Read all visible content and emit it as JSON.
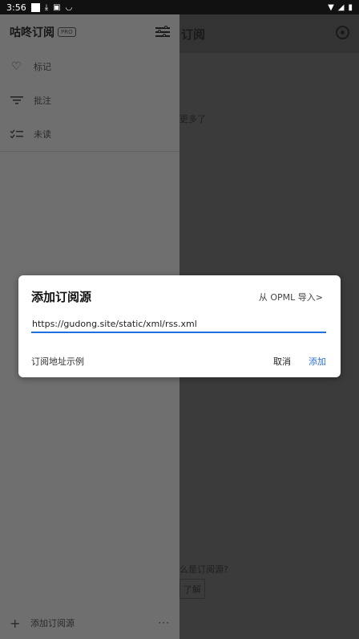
{
  "status_bar": {
    "time": "3:56",
    "icons": [
      "square-icon",
      "download-icon",
      "image-icon",
      "signal-icon",
      "wifi-icon",
      "cell-icon",
      "battery-icon"
    ]
  },
  "main": {
    "title": "订阅",
    "hint": "更多了",
    "question": "么是订阅源?",
    "learn_button": "了解"
  },
  "drawer": {
    "title": "咕咚订阅",
    "badge": "PRO",
    "menu": [
      {
        "icon": "heart-icon",
        "label": "标记"
      },
      {
        "icon": "filter-lines-icon",
        "label": "批注"
      },
      {
        "icon": "checklist-icon",
        "label": "未读"
      }
    ],
    "footer": {
      "label": "添加订阅源",
      "more": "···"
    }
  },
  "dialog": {
    "title": "添加订阅源",
    "opml_link": "从 OPML 导入>",
    "input_value": "https://gudong.site/static/xml/rss.xml",
    "example_link": "订阅地址示例",
    "cancel": "取消",
    "add": "添加",
    "accent": "#1e6fe0"
  }
}
